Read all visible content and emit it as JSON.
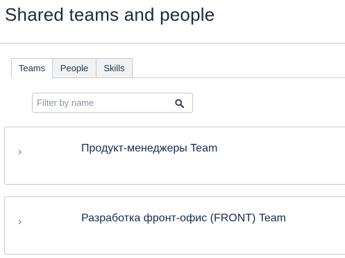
{
  "page": {
    "title": "Shared teams and people"
  },
  "tabs": [
    {
      "label": "Teams",
      "active": true
    },
    {
      "label": "People",
      "active": false
    },
    {
      "label": "Skills",
      "active": false
    }
  ],
  "filter": {
    "placeholder": "Filter by name",
    "value": "",
    "icon": "search-icon"
  },
  "teams": [
    {
      "name": "Продукт-менеджеры Team",
      "expand_icon": "chevron-right-icon"
    },
    {
      "name": "Разработка фронт-офис (FRONT) Team",
      "expand_icon": "chevron-right-icon"
    }
  ]
}
